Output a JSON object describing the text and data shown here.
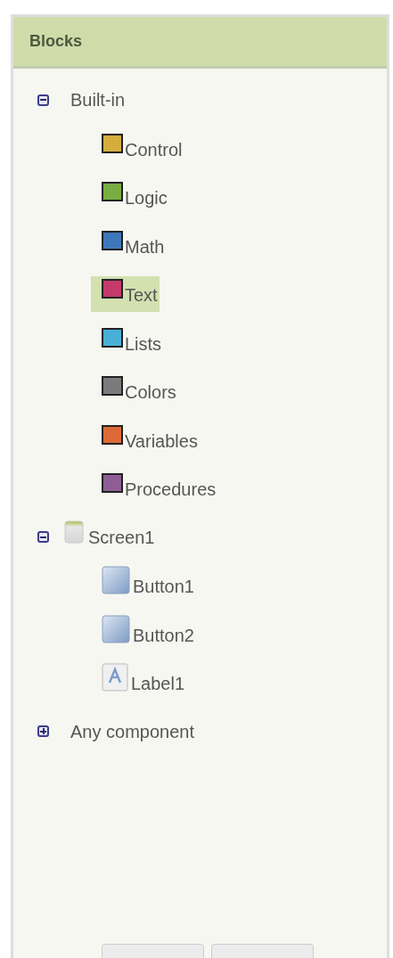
{
  "panel": {
    "title": "Blocks"
  },
  "tree": [
    {
      "label": "Built-in",
      "expanded": true,
      "children": [
        {
          "label": "Control",
          "kind": "block",
          "color": "#d4ad3c",
          "selected": false
        },
        {
          "label": "Logic",
          "kind": "block",
          "color": "#78ad43",
          "selected": false
        },
        {
          "label": "Math",
          "kind": "block",
          "color": "#3f78b9",
          "selected": false
        },
        {
          "label": "Text",
          "kind": "block",
          "color": "#c43a6b",
          "selected": true
        },
        {
          "label": "Lists",
          "kind": "block",
          "color": "#48b0d6",
          "selected": false
        },
        {
          "label": "Colors",
          "kind": "block",
          "color": "#7b7b7b",
          "selected": false
        },
        {
          "label": "Variables",
          "kind": "block",
          "color": "#dd6a36",
          "selected": false
        },
        {
          "label": "Procedures",
          "kind": "block",
          "color": "#8e5d95",
          "selected": false
        }
      ]
    },
    {
      "label": "Screen1",
      "kind": "screen",
      "expanded": true,
      "children": [
        {
          "label": "Button1",
          "kind": "button",
          "selected": false
        },
        {
          "label": "Button2",
          "kind": "button",
          "selected": false
        },
        {
          "label": "Label1",
          "kind": "label",
          "selected": false
        }
      ]
    },
    {
      "label": "Any component",
      "expanded": false
    }
  ],
  "bottom_buttons": [
    {
      "kind": "cut-off"
    },
    {
      "kind": "cut-off"
    }
  ]
}
